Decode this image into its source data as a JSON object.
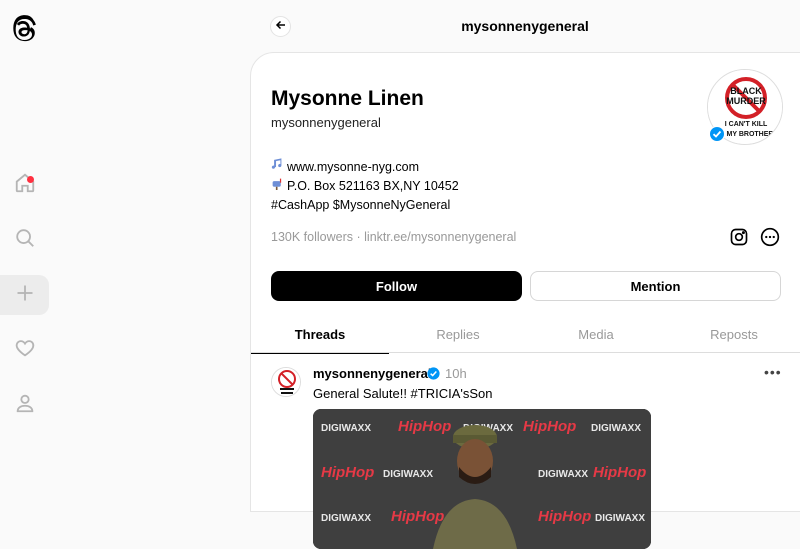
{
  "nav": {
    "items": [
      {
        "name": "home"
      },
      {
        "name": "search"
      },
      {
        "name": "create"
      },
      {
        "name": "activity"
      },
      {
        "name": "profile"
      }
    ]
  },
  "topbar": {
    "title": "mysonnenygeneral"
  },
  "profile": {
    "name": "Mysonne Linen",
    "handle": "mysonnenygeneral",
    "avatar_text": {
      "line1": "BLACK",
      "line2": "MURDER",
      "line3": "I CAN'T KILL",
      "line4": "MY BROTHER"
    },
    "bio": [
      {
        "icon": "music-note-icon",
        "text": "www.mysonne-nyg.com"
      },
      {
        "icon": "mailbox-icon",
        "text": "P.O. Box 521163 BX,NY 10452"
      },
      {
        "icon": "",
        "text": "#CashApp $MysonneNyGeneral"
      }
    ],
    "followers": "130K followers",
    "separator": "·",
    "link": "linktr.ee/mysonnenygeneral"
  },
  "actions": {
    "follow": "Follow",
    "mention": "Mention"
  },
  "tabs": [
    "Threads",
    "Replies",
    "Media",
    "Reposts"
  ],
  "post": {
    "user": "mysonnenygeneral",
    "time": "10h",
    "text": "General Salute!! #TRICIA'sSon",
    "image_brands": [
      "DIGIWAXX",
      "HipHop"
    ]
  },
  "colors": {
    "accent": "#000000",
    "notification": "#ff3040",
    "verified": "#0095f6",
    "muted": "#999999"
  }
}
